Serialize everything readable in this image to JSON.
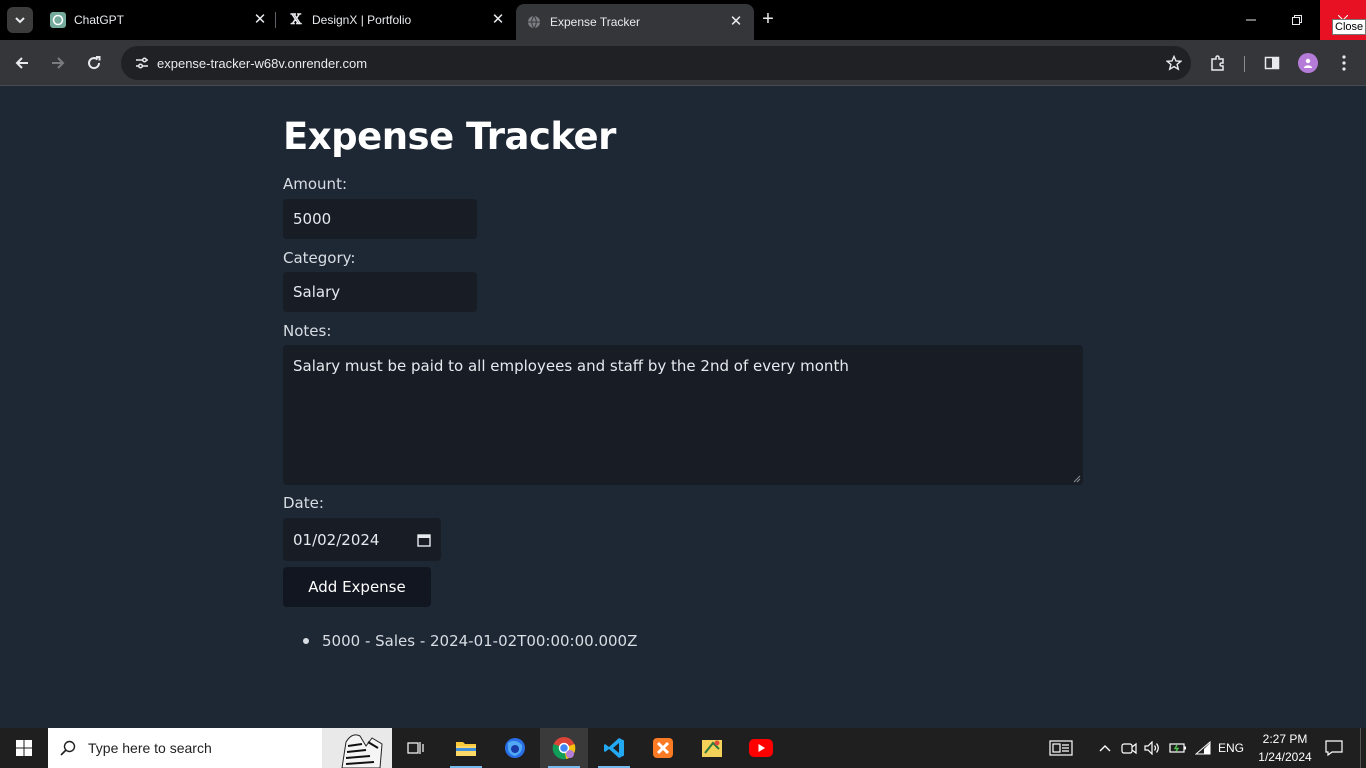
{
  "browser": {
    "tabs": [
      {
        "title": "ChatGPT",
        "icon": "chatgpt-icon"
      },
      {
        "title": "DesignX | Portfolio",
        "icon": "designx-icon"
      },
      {
        "title": "Expense Tracker",
        "icon": "globe-icon",
        "active": true
      }
    ],
    "url": "expense-tracker-w68v.onrender.com",
    "close_tooltip": "Close"
  },
  "page": {
    "title": "Expense Tracker",
    "amount_label": "Amount:",
    "amount_value": "5000",
    "category_label": "Category:",
    "category_value": "Salary",
    "notes_label": "Notes:",
    "notes_value": "Salary must be paid to all employees and staff by the 2nd of every month",
    "date_label": "Date:",
    "date_value": "01/02/2024",
    "add_button": "Add Expense",
    "expenses": [
      "5000 - Sales - 2024-01-02T00:00:00.000Z"
    ]
  },
  "taskbar": {
    "search_placeholder": "Type here to search",
    "apps": [
      "task-view-icon",
      "file-explorer-icon",
      "firefox-icon",
      "chrome-icon",
      "vscode-icon",
      "xampp-icon",
      "sticky-app-icon",
      "youtube-icon"
    ],
    "language": "ENG",
    "time": "2:27 PM",
    "date": "1/24/2024"
  },
  "colors": {
    "page_bg": "#1e2835",
    "input_bg": "#171c25",
    "button_bg": "#111620",
    "close_red": "#e81123"
  }
}
